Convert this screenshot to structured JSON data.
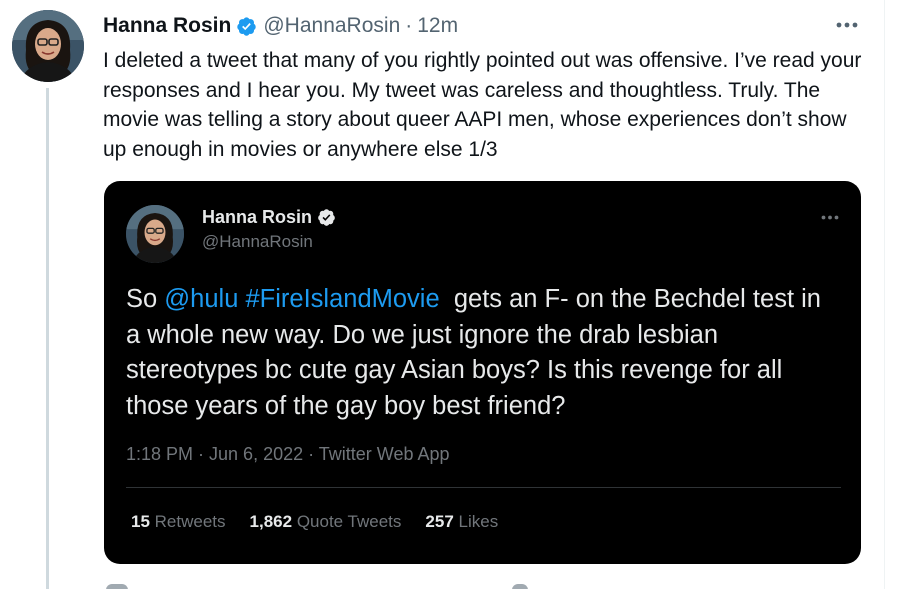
{
  "tweet": {
    "author_name": "Hanna Rosin",
    "handle": "@HannaRosin",
    "separator": "·",
    "time": "12m",
    "text": "I deleted a tweet that many of you rightly pointed out was offensive. I’ve read your responses and I hear you. My tweet was careless and thoughtless. Truly. The movie was telling a story about queer AAPI men, whose experiences don’t show up enough in movies or anywhere else 1/3",
    "more_icon": "more-horizontal-icon",
    "verified_icon": "verified-badge-icon"
  },
  "quoted_tweet": {
    "author_name": "Hanna Rosin",
    "handle": "@HannaRosin",
    "text_before": "So ",
    "mention": "@hulu",
    "text_middle": " ",
    "hashtag": "#FireIslandMovie",
    "text_after": "  gets an F- on the Bechdel test in a whole new way. Do we just ignore the drab lesbian stereotypes bc cute gay Asian boys? Is this revenge for all those years of the gay boy best friend?",
    "meta": "1:18 PM · Jun 6, 2022 · Twitter Web App",
    "stats": {
      "retweets_count": "15",
      "retweets_label": "Retweets",
      "quotes_count": "1,862",
      "quotes_label": "Quote Tweets",
      "likes_count": "257",
      "likes_label": "Likes"
    }
  },
  "colors": {
    "accent": "#1d9bf0",
    "text_primary": "#0f1419",
    "text_secondary": "#536471",
    "card_background": "#000000",
    "card_text": "#e7e9ea",
    "card_muted": "#71767b",
    "thread_line": "#cfd9de"
  }
}
